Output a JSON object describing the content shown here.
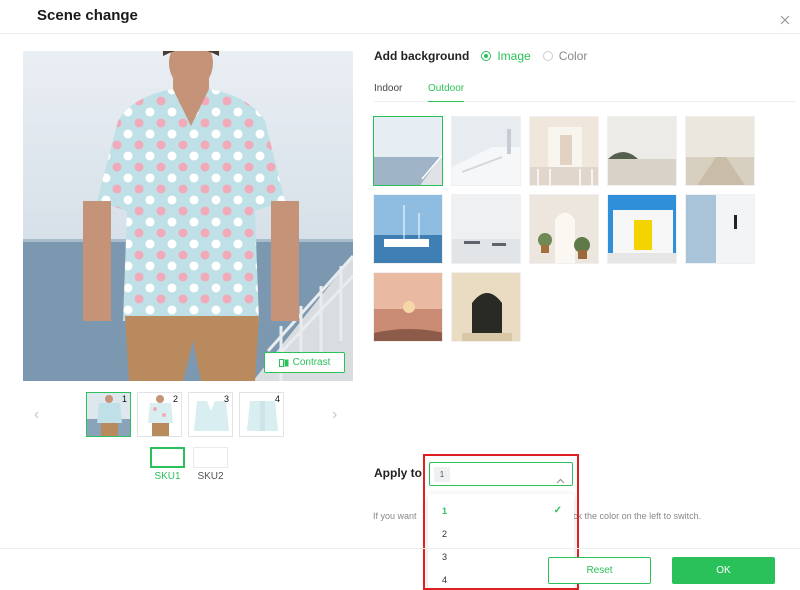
{
  "modal": {
    "title": "Scene change",
    "close_icon": "close-icon"
  },
  "preview": {
    "contrast_label": "Contrast",
    "contrast_icon": "compare-icon"
  },
  "thumbnails": [
    {
      "number": "1",
      "active": true
    },
    {
      "number": "2",
      "active": false
    },
    {
      "number": "3",
      "active": false
    },
    {
      "number": "4",
      "active": false
    }
  ],
  "nav": {
    "prev_icon": "chevron-left-icon",
    "next_icon": "chevron-right-icon",
    "prev_glyph": "‹",
    "next_glyph": "›"
  },
  "skus": [
    {
      "label": "SKU1",
      "active": true
    },
    {
      "label": "SKU2",
      "active": false
    }
  ],
  "background": {
    "label": "Add background",
    "options": [
      {
        "label": "Image",
        "selected": true
      },
      {
        "label": "Color",
        "selected": false
      }
    ]
  },
  "tabs": [
    {
      "label": "Indoor",
      "active": false
    },
    {
      "label": "Outdoor",
      "active": true
    }
  ],
  "scenes": [
    {
      "name": "pier-sea",
      "selected": true
    },
    {
      "name": "white-steps",
      "selected": false
    },
    {
      "name": "arch-balcony",
      "selected": false
    },
    {
      "name": "beach-rocks",
      "selected": false
    },
    {
      "name": "long-pier",
      "selected": false
    },
    {
      "name": "yacht-harbor",
      "selected": false
    },
    {
      "name": "misty-boats",
      "selected": false
    },
    {
      "name": "plants-archway",
      "selected": false
    },
    {
      "name": "yellow-door",
      "selected": false
    },
    {
      "name": "white-balcony-door",
      "selected": false
    },
    {
      "name": "sunset-beach",
      "selected": false
    },
    {
      "name": "arched-doorway",
      "selected": false
    }
  ],
  "apply": {
    "label": "Apply to",
    "selected_tag": "1",
    "hint_start": "If you want",
    "hint_end": "ease click the color on the left to switch.",
    "options": [
      {
        "label": "1",
        "selected": true
      },
      {
        "label": "2",
        "selected": false
      },
      {
        "label": "3",
        "selected": false
      },
      {
        "label": "4",
        "selected": false
      }
    ],
    "check_glyph": "✓"
  },
  "footer": {
    "reset_label": "Reset",
    "ok_label": "OK"
  },
  "colors": {
    "accent": "#2bc15a",
    "highlight": "#e02020"
  }
}
